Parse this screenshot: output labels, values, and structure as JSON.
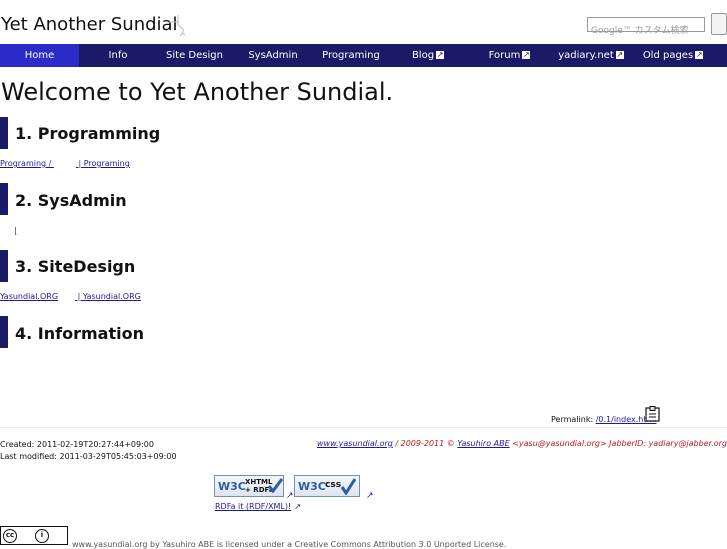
{
  "header": {
    "site_title": "Yet Another Sundial",
    "search_placeholder": "Google™ カスタム検索"
  },
  "nav": [
    {
      "label": "Home",
      "external": false,
      "active": true
    },
    {
      "label": "Info",
      "external": false,
      "active": false
    },
    {
      "label": "Site Design",
      "external": false,
      "active": false
    },
    {
      "label": "SysAdmin",
      "external": false,
      "active": false
    },
    {
      "label": "Programing",
      "external": false,
      "active": false
    },
    {
      "label": "Blog",
      "external": true,
      "active": false
    },
    {
      "label": "Forum",
      "external": true,
      "active": false
    },
    {
      "label": "yadiary.net",
      "external": true,
      "active": false
    },
    {
      "label": "Old pages",
      "external": true,
      "active": false
    }
  ],
  "main": {
    "title": "Welcome to Yet Another Sundial.",
    "sections": [
      {
        "heading": "1. Programming",
        "links": [
          "Programing / ",
          " | Programing"
        ]
      },
      {
        "heading": "2. SysAdmin",
        "links": [
          "",
          " | "
        ]
      },
      {
        "heading": "3. SiteDesign",
        "links": [
          "Yasundial.ORG",
          " | Yasundial.ORG"
        ]
      },
      {
        "heading": "4. Information",
        "links": [
          ""
        ]
      }
    ]
  },
  "permalink": {
    "label": "Permalink: ",
    "link": "/0.1/index.html"
  },
  "footer": {
    "created": "Created: 2011-02-19T20:27:44+09:00",
    "modified": "Last modified: 2011-03-29T05:45:03+09:00",
    "site_link": "www.yasundial.org",
    "copyright": " / 2009-2011 © ",
    "author_link": "Yasuhiro ABE",
    "contact": " <yasu@yasundial.org> JabberID: yadiary@jabber.org",
    "badge_xhtml_w3c": "W3C",
    "badge_xhtml_kind_1": "XHTML",
    "badge_xhtml_kind_2": "+ RDFa",
    "badge_css_w3c": "W3C",
    "badge_css_kind": "css",
    "rdfa_link": "RDFa it (RDF/XML)!",
    "cc_label": "cc",
    "by_label": "i",
    "license": "www.yasundial.org by Yasuhiro ABE is licensed under a Creative Commons Attribution 3.0 Unported License."
  }
}
